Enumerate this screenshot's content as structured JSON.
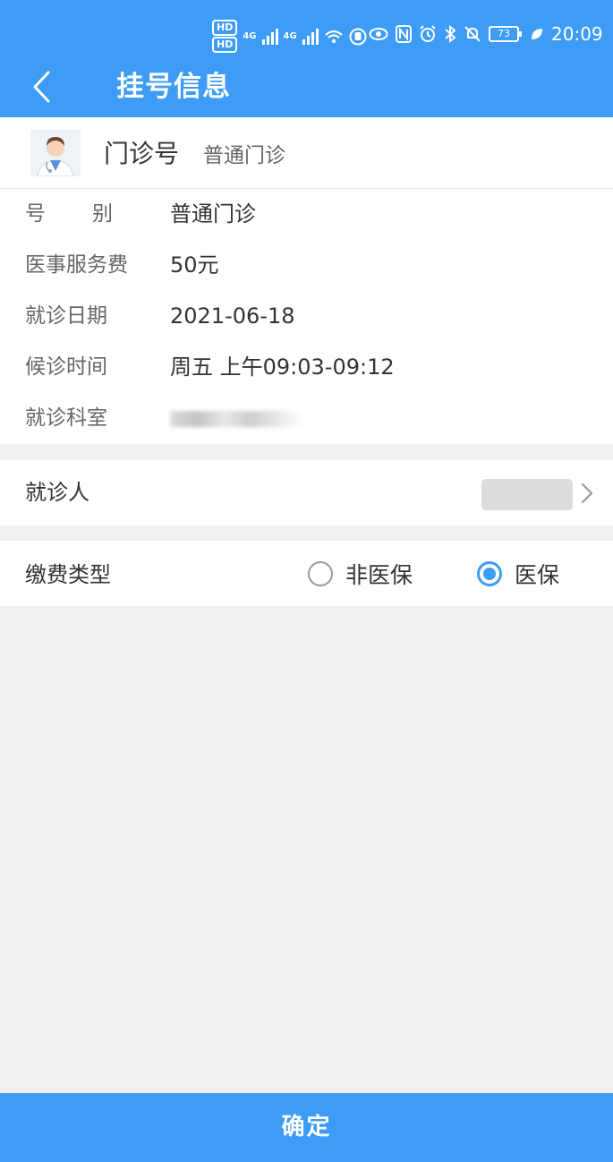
{
  "status_bar": {
    "time": "20:09",
    "battery": "73",
    "hd_label": "HD",
    "network_label": "4G",
    "icons": [
      "hd-icon",
      "signal-4g-icon",
      "signal-4g-icon",
      "wifi-icon",
      "hand-icon",
      "eye-icon",
      "nfc-icon",
      "alarm-icon",
      "bluetooth-icon",
      "mute-icon",
      "battery-icon",
      "leaf-icon"
    ]
  },
  "header": {
    "title": "挂号信息",
    "back_icon": "chevron-left-icon",
    "color": "#3d9cf5"
  },
  "clinic": {
    "type": "门诊号",
    "name": "普通门诊",
    "avatar_icon": "doctor-avatar-icon"
  },
  "info": [
    {
      "label": "号别",
      "label_parts": [
        "号",
        "别"
      ],
      "value": "普通门诊"
    },
    {
      "label": "医事服务费",
      "value": "50元"
    },
    {
      "label": "就诊日期",
      "value": "2021-06-18"
    },
    {
      "label": "候诊时间",
      "value": "周五 上午09:03-09:12"
    },
    {
      "label": "就诊科室",
      "value": ""
    }
  ],
  "patient": {
    "label": "就诊人",
    "value": "",
    "arrow_icon": "chevron-right-icon"
  },
  "payment": {
    "label": "缴费类型",
    "options": [
      {
        "label": "非医保",
        "selected": false
      },
      {
        "label": "医保",
        "selected": true
      }
    ]
  },
  "confirm_button": "确定"
}
